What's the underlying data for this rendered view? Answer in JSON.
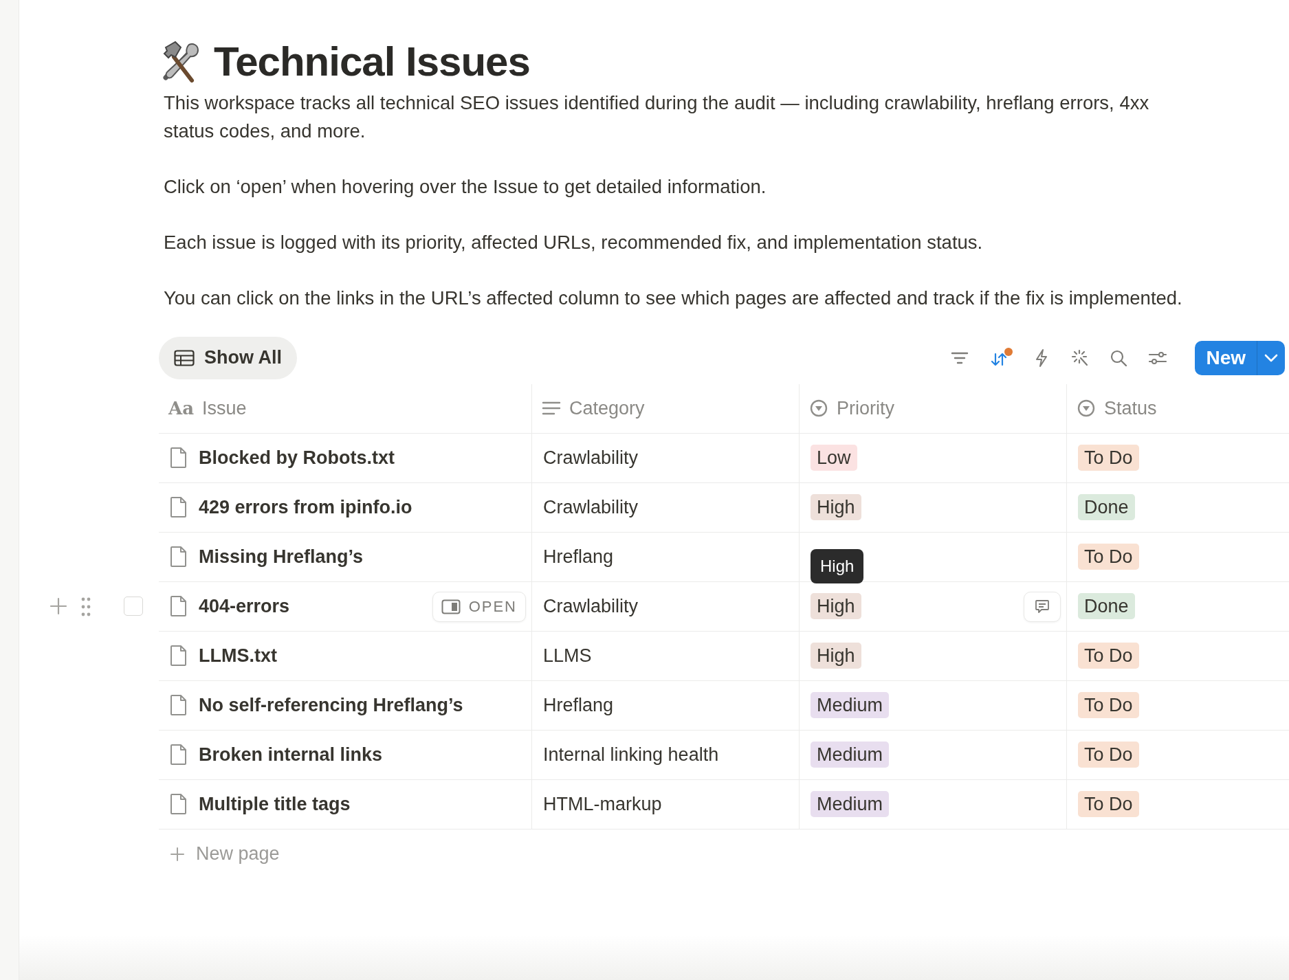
{
  "page": {
    "title": "Technical Issues",
    "description": [
      "This workspace tracks all technical SEO issues identified during the audit — including crawlability, hreflang errors,  4xx status codes, and more.",
      "Click on ‘open’ when hovering over the Issue to get detailed information.",
      "Each issue is logged with its priority, affected URLs, recommended fix, and implementation status.",
      "You can click on the links in the URL’s affected column to see which pages are affected and track if the fix is implemented."
    ]
  },
  "view": {
    "label": "Show All"
  },
  "toolbar": [
    {
      "kind": "filter",
      "active": false
    },
    {
      "kind": "sort",
      "active": true
    },
    {
      "kind": "automation",
      "active": false
    },
    {
      "kind": "ai",
      "active": false
    },
    {
      "kind": "search",
      "active": false
    },
    {
      "kind": "settings",
      "active": false
    }
  ],
  "new_button": {
    "label": "New"
  },
  "columns": [
    {
      "kind": "title",
      "icon_text": "Aa",
      "label": "Issue"
    },
    {
      "kind": "text",
      "label": "Category"
    },
    {
      "kind": "select",
      "label": "Priority"
    },
    {
      "kind": "select",
      "label": "Status"
    }
  ],
  "rows": [
    {
      "issue": "Blocked by Robots.txt",
      "category": "Crawlability",
      "priority": {
        "label": "Low",
        "color": "#fbe2e2"
      },
      "status": {
        "label": "To Do",
        "color": "#f9e1d2"
      },
      "hovered": false
    },
    {
      "issue": "429 errors from ipinfo.io",
      "category": "Crawlability",
      "priority": {
        "label": "High",
        "color": "#eee0da"
      },
      "status": {
        "label": "Done",
        "color": "#dbeadd"
      },
      "hovered": false
    },
    {
      "issue": "Missing Hreflang’s",
      "category": "Hreflang",
      "tooltip": "High",
      "status": {
        "label": "To Do",
        "color": "#f9e1d2"
      },
      "hovered": false
    },
    {
      "issue": "404-errors",
      "category": "Crawlability",
      "priority": {
        "label": "High",
        "color": "#eee0da"
      },
      "status": {
        "label": "Done",
        "color": "#dbeadd"
      },
      "hovered": true,
      "checked": false,
      "open_label": "OPEN"
    },
    {
      "issue": "LLMS.txt",
      "category": "LLMS",
      "priority": {
        "label": "High",
        "color": "#eee0da"
      },
      "status": {
        "label": "To Do",
        "color": "#f9e1d2"
      },
      "hovered": false
    },
    {
      "issue": "No self-referencing Hreflang’s",
      "category": "Hreflang",
      "priority": {
        "label": "Medium",
        "color": "#e8deef"
      },
      "status": {
        "label": "To Do",
        "color": "#f9e1d2"
      },
      "hovered": false
    },
    {
      "issue": "Broken internal links",
      "category": "Internal linking health",
      "priority": {
        "label": "Medium",
        "color": "#e8deef"
      },
      "status": {
        "label": "To Do",
        "color": "#f9e1d2"
      },
      "hovered": false
    },
    {
      "issue": "Multiple title tags",
      "category": "HTML-markup",
      "priority": {
        "label": "Medium",
        "color": "#e8deef"
      },
      "status": {
        "label": "To Do",
        "color": "#f9e1d2"
      },
      "hovered": false
    }
  ],
  "new_row": {
    "label": "New page"
  }
}
